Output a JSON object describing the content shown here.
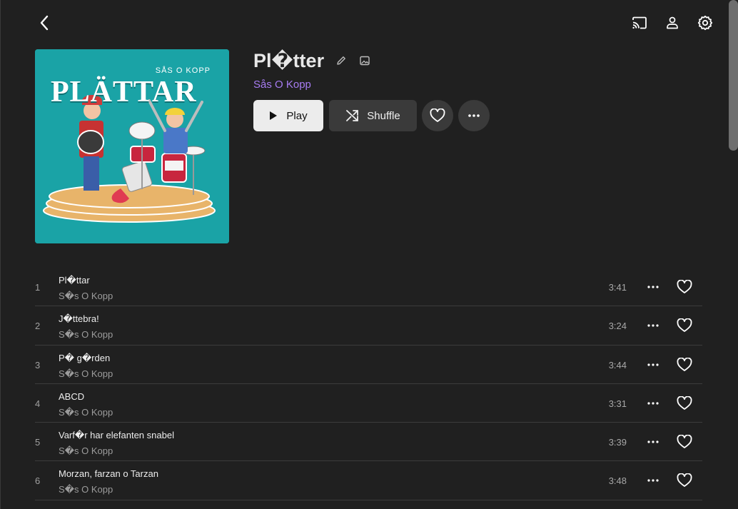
{
  "header": {
    "back_icon": "chevron-left-icon",
    "cast_icon": "cast-icon",
    "user_icon": "user-icon",
    "settings_icon": "gear-icon"
  },
  "album": {
    "cover_artist": "SÅS O KOPP",
    "cover_title": "PLÄTTAR",
    "title": "Pl�tter",
    "artist": "Sås O Kopp",
    "edit_icon": "pencil-icon",
    "image_icon": "image-icon"
  },
  "actions": {
    "play_label": "Play",
    "shuffle_label": "Shuffle",
    "favorite_icon": "heart-icon",
    "more_icon": "more-horizontal-icon"
  },
  "tracks": [
    {
      "number": "1",
      "title": "Pl�ttar",
      "artist": "S�s O Kopp",
      "duration": "3:41"
    },
    {
      "number": "2",
      "title": "J�ttebra!",
      "artist": "S�s O Kopp",
      "duration": "3:24"
    },
    {
      "number": "3",
      "title": "P� g�rden",
      "artist": "S�s O Kopp",
      "duration": "3:44"
    },
    {
      "number": "4",
      "title": "ABCD",
      "artist": "S�s O Kopp",
      "duration": "3:31"
    },
    {
      "number": "5",
      "title": "Varf�r har elefanten snabel",
      "artist": "S�s O Kopp",
      "duration": "3:39"
    },
    {
      "number": "6",
      "title": "Morzan, farzan o Tarzan",
      "artist": "S�s O Kopp",
      "duration": "3:48"
    }
  ],
  "colors": {
    "background": "#202020",
    "accent": "#a77cf2",
    "play_button": "#ececec",
    "secondary_button": "#3a3a3a",
    "cover_teal": "#1aa3a6"
  }
}
